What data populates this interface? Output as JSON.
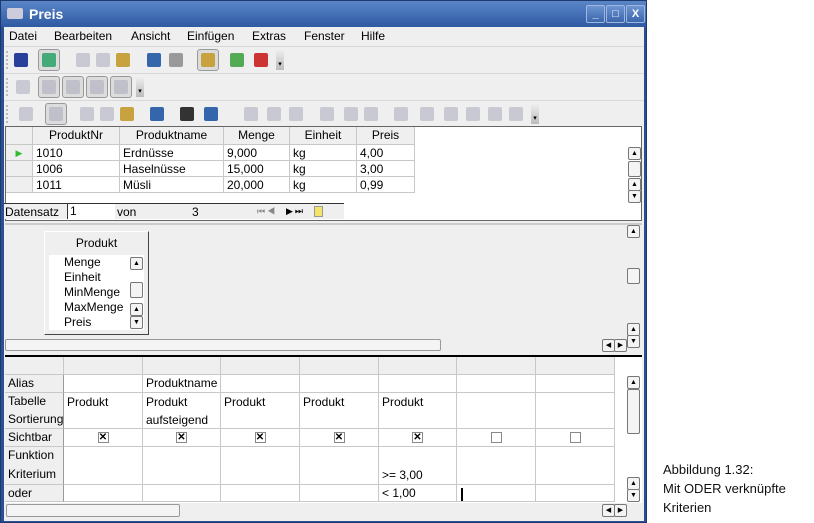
{
  "window": {
    "title": "Preis",
    "min": "_",
    "max": "□",
    "close": "X"
  },
  "menu": [
    "Datei",
    "Bearbeiten",
    "Ansicht",
    "Einfügen",
    "Extras",
    "Fenster",
    "Hilfe"
  ],
  "toolbar1": [
    "save-icon",
    "edit-icon",
    "cut-icon",
    "copy-icon",
    "paste-icon",
    "undo-icon",
    "redo-icon",
    "design-view-icon",
    "run-query-icon",
    "clear-query-icon"
  ],
  "toolbar2": [
    "add-table-icon",
    "functions-icon",
    "table-name-icon",
    "alias-icon",
    "distinct-values-icon"
  ],
  "toolbar3": [
    "save-record-icon",
    "edit-data-icon",
    "cut-icon",
    "copy-icon",
    "paste-icon",
    "undo-icon",
    "find-icon",
    "refresh-icon",
    "sort-icon",
    "sort-ascending-icon",
    "sort-descending-icon",
    "autofilter-icon",
    "apply-filter-icon",
    "standard-filter-icon",
    "remove-filter-icon",
    "data-to-text-icon",
    "data-to-fields-icon",
    "mail-merge-icon",
    "data-source-icon",
    "explorer-icon"
  ],
  "datagrid": {
    "columns": [
      "ProduktNr",
      "Produktname",
      "Menge",
      "Einheit",
      "Preis"
    ],
    "rows": [
      [
        "1010",
        "Erdnüsse",
        "9,000",
        "kg",
        "4,00"
      ],
      [
        "1006",
        "Haselnüsse",
        "15,000",
        "kg",
        "3,00"
      ],
      [
        "1011",
        "Müsli",
        "20,000",
        "kg",
        "0,99"
      ]
    ],
    "nav": {
      "label": "Datensatz",
      "current": "1",
      "of": "von",
      "total": "3"
    }
  },
  "table_box": {
    "title": "Produkt",
    "fields": [
      "Menge",
      "Einheit",
      "MinMenge",
      "MaxMenge",
      "Preis"
    ]
  },
  "query_grid": {
    "row_labels": [
      "Alias",
      "Tabelle",
      "Sortierung",
      "Sichtbar",
      "Funktion",
      "Kriterium",
      "oder"
    ],
    "columns": [
      {
        "alias": "",
        "table": "Produkt",
        "sort": "",
        "visible": true,
        "criterion": "",
        "or": ""
      },
      {
        "alias": "Produktname",
        "table": "Produkt",
        "sort": "aufsteigend",
        "visible": true,
        "criterion": "",
        "or": ""
      },
      {
        "alias": "",
        "table": "Produkt",
        "sort": "",
        "visible": true,
        "criterion": "",
        "or": ""
      },
      {
        "alias": "",
        "table": "Produkt",
        "sort": "",
        "visible": true,
        "criterion": "",
        "or": ""
      },
      {
        "alias": "",
        "table": "Produkt",
        "sort": "",
        "visible": true,
        "criterion": ">= 3,00",
        "or": "< 1,00"
      },
      {
        "alias": "",
        "table": "",
        "sort": "",
        "visible": false,
        "criterion": "",
        "or": ""
      },
      {
        "alias": "",
        "table": "",
        "sort": "",
        "visible": false,
        "criterion": "",
        "or": ""
      }
    ]
  },
  "caption": {
    "line1": "Abbildung 1.32:",
    "line2": "Mit ODER verknüpfte",
    "line3": "Kriterien"
  }
}
